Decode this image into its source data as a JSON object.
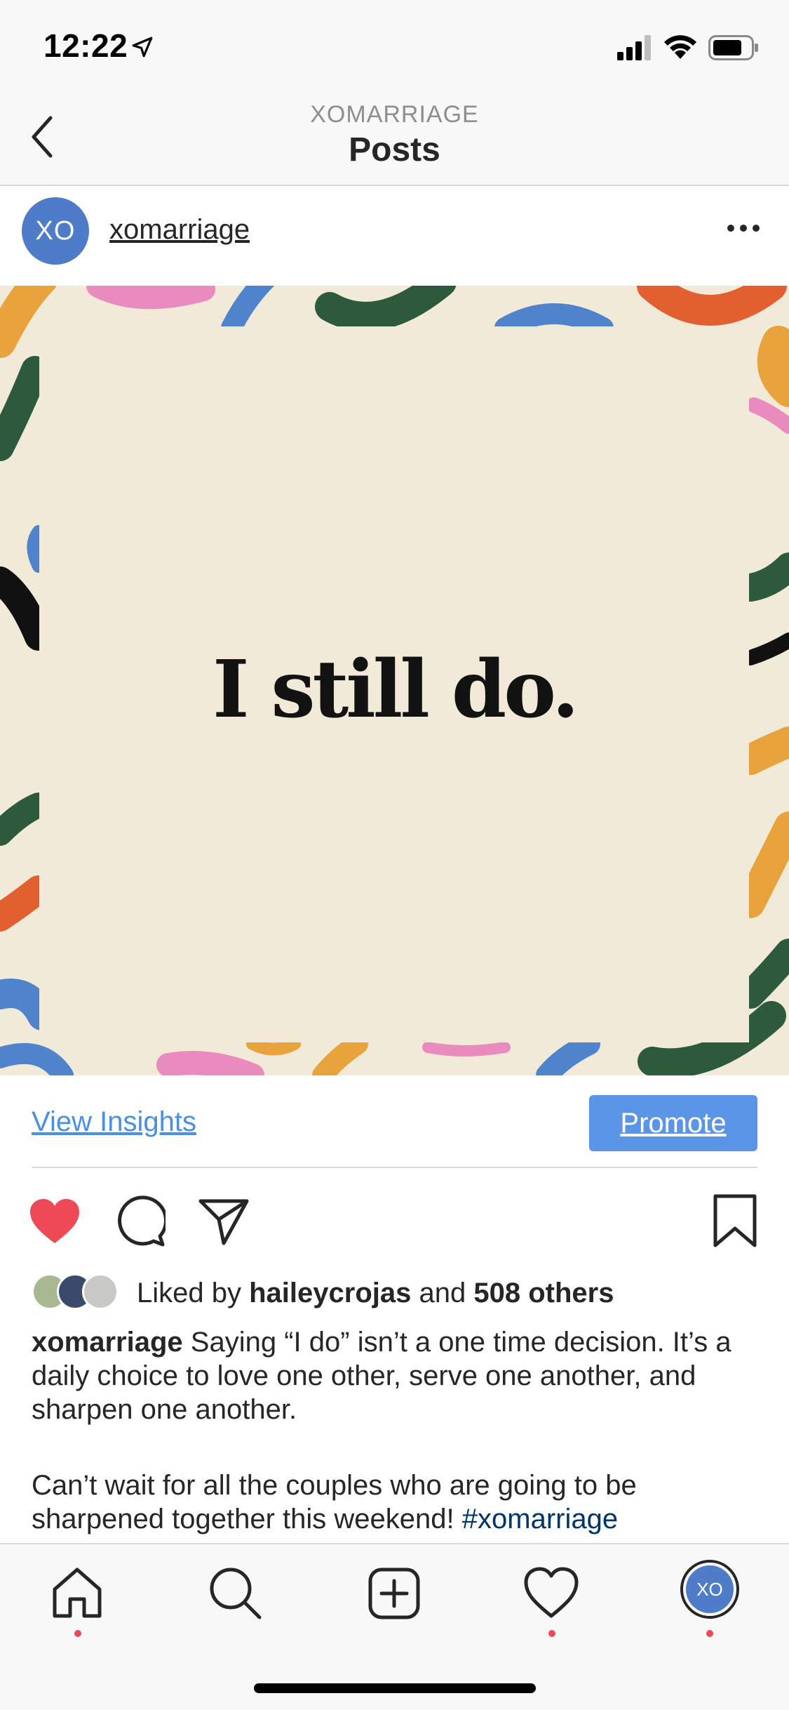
{
  "status_bar": {
    "time": "12:22"
  },
  "nav": {
    "subtitle": "XOMARRIAGE",
    "title": "Posts"
  },
  "post": {
    "avatar_text": "XO",
    "username": "xomarriage",
    "image_text": "I still do.",
    "image_colors": {
      "background": "#f1ead8",
      "orange": "#e8a33c",
      "pink": "#e98bbe",
      "blue": "#4f84cc",
      "green": "#2d5a3d",
      "red_orange": "#e2602f",
      "black": "#111111"
    }
  },
  "insights": {
    "view_label": "View Insights",
    "promote_label": "Promote"
  },
  "likes": {
    "prefix": "Liked by",
    "user": "haileycrojas",
    "joiner": "and",
    "others": "508 others"
  },
  "caption": {
    "username": "xomarriage",
    "text": "Saying “I do” isn’t a one time decision. It’s a daily choice to love one other, serve one another, and sharpen one another.",
    "text2": "Can’t wait for all the couples who are going to be sharpened together this weekend!",
    "hashtag": "#xomarriage"
  },
  "tab_bar": {
    "avatar_text": "XO"
  },
  "colors": {
    "accent_blue": "#4a90e2",
    "promote_bg": "#5b95e8",
    "like_red": "#ed4956"
  }
}
